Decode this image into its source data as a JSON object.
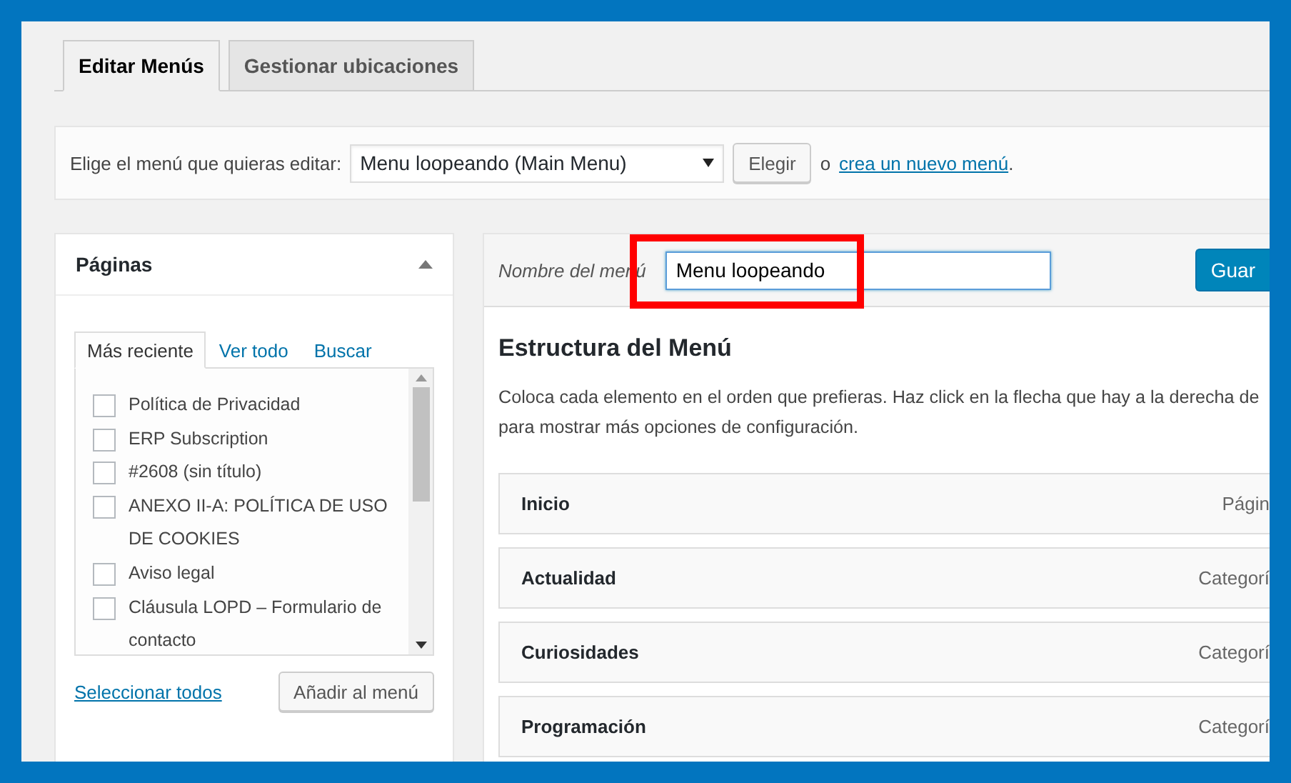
{
  "tabs": [
    {
      "label": "Editar Menús",
      "selected": true
    },
    {
      "label": "Gestionar ubicaciones",
      "selected": false
    }
  ],
  "chooser": {
    "label": "Elige el menú que quieras editar:",
    "select_value": "Menu loopeando (Main Menu)",
    "button": "Elegir",
    "or_text": "o",
    "link": "crea un nuevo menú",
    "period": "."
  },
  "pages_panel": {
    "title": "Páginas",
    "expanded": true,
    "tabs": [
      {
        "label": "Más reciente",
        "selected": true
      },
      {
        "label": "Ver todo",
        "selected": false
      },
      {
        "label": "Buscar",
        "selected": false
      }
    ],
    "items": [
      {
        "label": "Política de Privacidad",
        "checked": false
      },
      {
        "label": "ERP Subscription",
        "checked": false
      },
      {
        "label": "#2608 (sin título)",
        "checked": false
      },
      {
        "label": "ANEXO II-A: POLÍTICA DE USO DE COOKIES",
        "checked": false
      },
      {
        "label": "Aviso legal",
        "checked": false
      },
      {
        "label": "Cláusula LOPD – Formulario de contacto",
        "checked": false
      }
    ],
    "select_all": "Seleccionar todos",
    "add_button": "Añadir al menú"
  },
  "menu_editor": {
    "name_label": "Nombre del menú",
    "name_value": "Menu loopeando",
    "save_button": "Guar",
    "heading": "Estructura del Menú",
    "description": "Coloca cada elemento en el orden que prefieras. Haz click en la flecha que hay a la derecha de para mostrar más opciones de configuración.",
    "items": [
      {
        "title": "Inicio",
        "type": "Págin"
      },
      {
        "title": "Actualidad",
        "type": "Categorí"
      },
      {
        "title": "Curiosidades",
        "type": "Categorí"
      },
      {
        "title": "Programación",
        "type": "Categorí"
      }
    ]
  }
}
